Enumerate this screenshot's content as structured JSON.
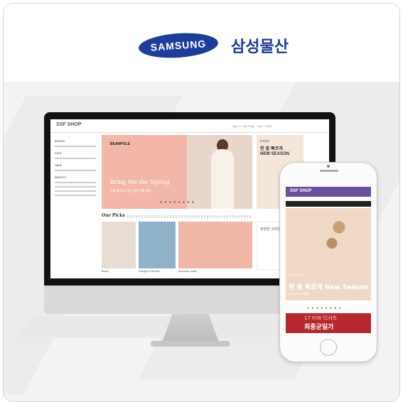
{
  "brand": {
    "logo_text": "SAMSUNG",
    "company_name": "삼성물산",
    "color": "#1d3d9a"
  },
  "desktop": {
    "site_logo": "SSF SHOP",
    "nav_text": "Sign In · My Page · Cart · Order",
    "banner": {
      "brand": "BEANPOLE",
      "headline": "Bring Me the Spring",
      "subtext": "빈폴 레이디스 봄 신상품 특별 혜택",
      "dots": "● ● ● ● ● ● ● ●"
    },
    "event_panel": {
      "tag": "EVENT",
      "line1": "한 발 빠르게",
      "line2": "NEW SEASON"
    },
    "picks_title": "Our Picks",
    "event2_text": "장원한 스타일 Pick",
    "tile_captions": [
      "Beany",
      "Designer Collection",
      "Beanpole Ladies"
    ],
    "side_labels": [
      "BRAND",
      "KIDS",
      "SALE",
      "BEAUTY"
    ]
  },
  "mobile": {
    "site_logo": "SSF SHOP",
    "banner_tag": "SSF SHOP",
    "banner_headline": "한 발 빠르게 New Season",
    "banner_sub": "2018 S/S 신상품",
    "dots": "● ● ● ● ● ● ● ●",
    "promo_line1": "17 F/W 티셔츠",
    "promo_line2": "최종균일가"
  }
}
